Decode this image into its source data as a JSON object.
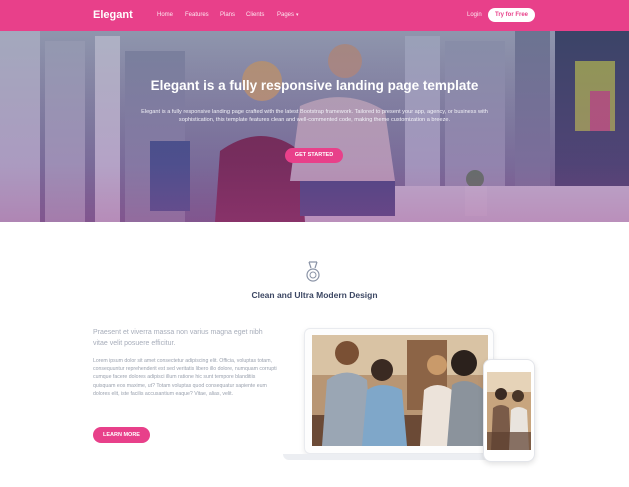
{
  "navbar": {
    "brand": "Elegant",
    "items": [
      "Home",
      "Features",
      "Plans",
      "Clients",
      "Pages"
    ],
    "login": "Login",
    "cta": "Try for Free"
  },
  "hero": {
    "title": "Elegant is a fully responsive landing page template",
    "text": "Elegant is a fully responsive landing page crafted with the latest Bootstrap framework. Tailored to present your app, agency, or business with sophistication, this template features clean and well-commented code, making theme customization a breeze.",
    "button": "GET STARTED"
  },
  "feature": {
    "icon": "medal-icon",
    "title": "Clean and Ultra Modern Design",
    "lead": "Praesent et viverra massa non varius magna eget nibh vitae velit posuere efficitur.",
    "body": "Lorem ipsum dolor sit amet consectetur adipiscing elit. Officia, voluptas totam, consequuntur reprehenderit est sed veritatis libero illo dolore, numquam corrupti cumque facere dolores adipisci illum ratione hic sunt tempore blanditiis quisquam eos maxime, ut? Totam voluptas quod consequatur sapiente eum dolores elit, iste facilis accusantium eaque? Vitae, alias, velit.",
    "button": "LEARN MORE"
  },
  "colors": {
    "brand": "#e8408a",
    "heading": "#3c4763",
    "muted": "#a7adba"
  }
}
